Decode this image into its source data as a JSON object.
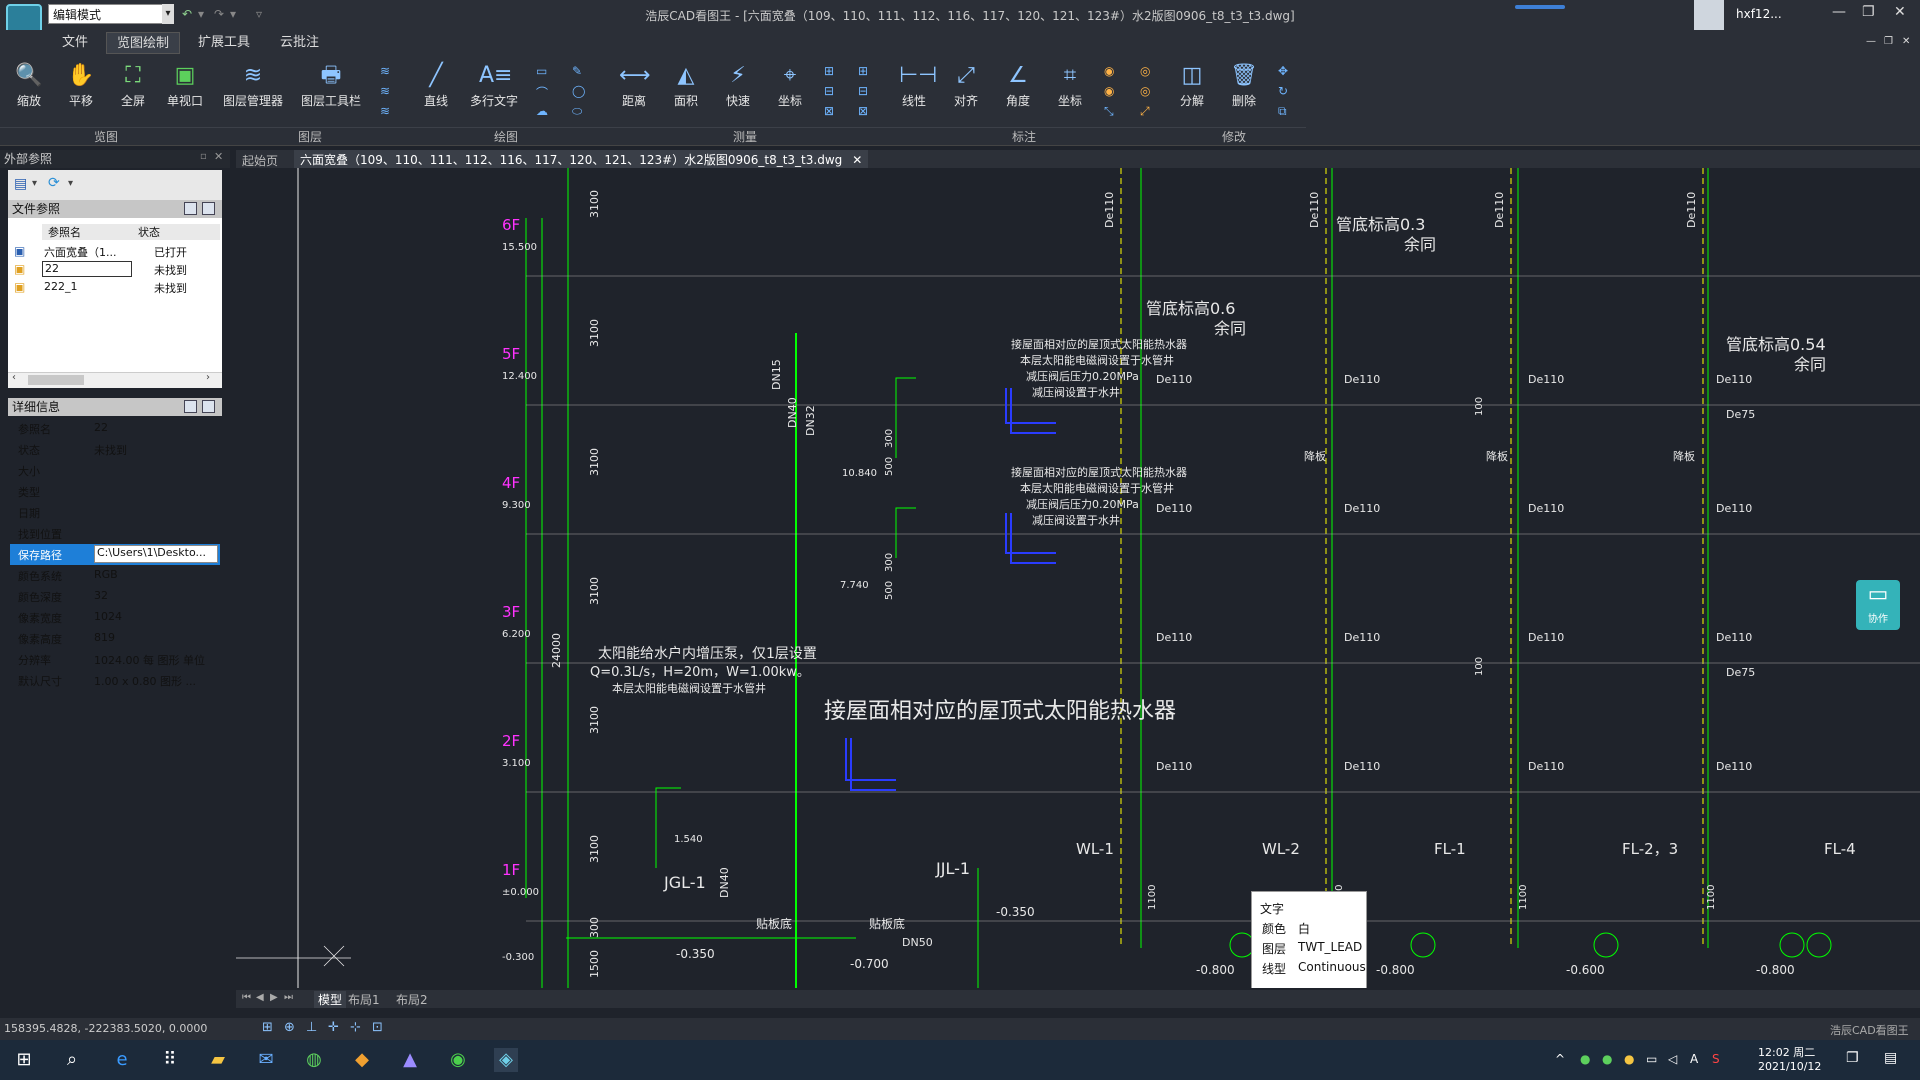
{
  "titlebar": {
    "mode": "编辑模式",
    "title": "浩辰CAD看图王 - [六面宽叠（109、110、111、112、116、117、120、121、123#）水2版图0906_t8_t3_t3.dwg]",
    "user": "hxf12..."
  },
  "menu": [
    "文件",
    "览图绘制",
    "扩展工具",
    "云批注"
  ],
  "ribbon": {
    "tools": [
      "缩放",
      "平移",
      "全屏",
      "单视口",
      "图层管理器",
      "图层工具栏",
      "直线",
      "多行文字",
      "距离",
      "面积",
      "快速",
      "坐标",
      "线性",
      "对齐",
      "角度",
      "坐标",
      "分解",
      "删除"
    ],
    "groups": [
      "览图",
      "图层",
      "绘图",
      "测量",
      "标注",
      "修改"
    ]
  },
  "panel": {
    "title": "外部参照",
    "file_ref_header": "文件参照",
    "col_name": "参照名",
    "col_status": "状态",
    "files": [
      {
        "name": "六面宽叠（1...",
        "status": "已打开"
      },
      {
        "name": "22",
        "status": "未找到"
      },
      {
        "name": "222_1",
        "status": "未找到"
      }
    ],
    "detail_header": "详细信息",
    "details": [
      {
        "k": "参照名",
        "v": "22"
      },
      {
        "k": "状态",
        "v": "未找到"
      },
      {
        "k": "大小",
        "v": ""
      },
      {
        "k": "类型",
        "v": ""
      },
      {
        "k": "日期",
        "v": ""
      },
      {
        "k": "找到位置",
        "v": ""
      },
      {
        "k": "保存路径",
        "v": "C:\\Users\\1\\Deskto..."
      },
      {
        "k": "颜色系统",
        "v": "RGB"
      },
      {
        "k": "颜色深度",
        "v": "32"
      },
      {
        "k": "像素宽度",
        "v": "1024"
      },
      {
        "k": "像素高度",
        "v": "819"
      },
      {
        "k": "分辨率",
        "v": "1024.00 每 图形 单位"
      },
      {
        "k": "默认尺寸",
        "v": "1.00 x 0.80 图形 ..."
      }
    ]
  },
  "tabs": {
    "start": "起始页",
    "doc": "六面宽叠（109、110、111、112、116、117、120、121、123#）水2版图0906_t8_t3_t3.dwg"
  },
  "layouts": [
    "模型",
    "布局1",
    "布局2"
  ],
  "status": {
    "coords": "158395.4828, -222383.5020, 0.0000",
    "brand": "浩辰CAD看图王"
  },
  "tooltip": {
    "title": "文字",
    "k1": "颜色",
    "v1": "白",
    "k2": "图层",
    "v2": "TWT_LEAD",
    "k3": "线型",
    "v3": "Continuous"
  },
  "collab": "协作",
  "taskbar": {
    "time": "12:02 周二",
    "date": "2021/10/12"
  },
  "drawing": {
    "floors": [
      {
        "f": "6F",
        "e": "15.500"
      },
      {
        "f": "5F",
        "e": "12.400"
      },
      {
        "f": "4F",
        "e": "9.300"
      },
      {
        "f": "3F",
        "e": "6.200"
      },
      {
        "f": "2F",
        "e": "3.100"
      },
      {
        "f": "1F",
        "e": "±0.000"
      }
    ],
    "dims": [
      "3100",
      "3100",
      "3100",
      "3100",
      "3100",
      "3100",
      "1500",
      "300",
      "24000"
    ],
    "labels": {
      "main": "接屋面相对应的屋顶式太阳能热水器",
      "note1": "接屋面相对应的屋顶式太阳能热水器",
      "note2": "本层太阳能电磁阀设置于水管井",
      "note3": "减压阀后压力0.20MPa",
      "note4": "减压阀设置于水井",
      "solar1": "太阳能给水户内增压泵，仅1层设置",
      "solar2": "Q=0.3L/s，H=20m，W=1.00kw。",
      "solar3": "本层太阳能电磁阀设置于水管井",
      "pipe1": "管底标高0.6",
      "pipe2": "管底标高0.3",
      "pipe3": "管底标高0.54",
      "rest": "余同",
      "jgl": "JGL-1",
      "jjl": "JJL-1",
      "wl1": "WL-1",
      "wl2": "WL-2",
      "fl1": "FL-1",
      "fl2": "FL-2，3",
      "fl4": "FL-4",
      "de110": "De110",
      "de75": "De75",
      "dn40": "DN40",
      "dn50": "DN50",
      "dn15": "DN15",
      "dn32": "DN32",
      "tieban": "贴板底",
      "jiangban": "降板",
      "lev1": "-0.350",
      "lev2": "-0.800",
      "lev3": "-0.600",
      "lev4": "-0.700",
      "e10": "10.840",
      "e7": "7.740",
      "e1": "1.540",
      "e03": "-0.300",
      "d100": "100",
      "d1100": "1100",
      "d500": "500",
      "d300": "300"
    }
  }
}
